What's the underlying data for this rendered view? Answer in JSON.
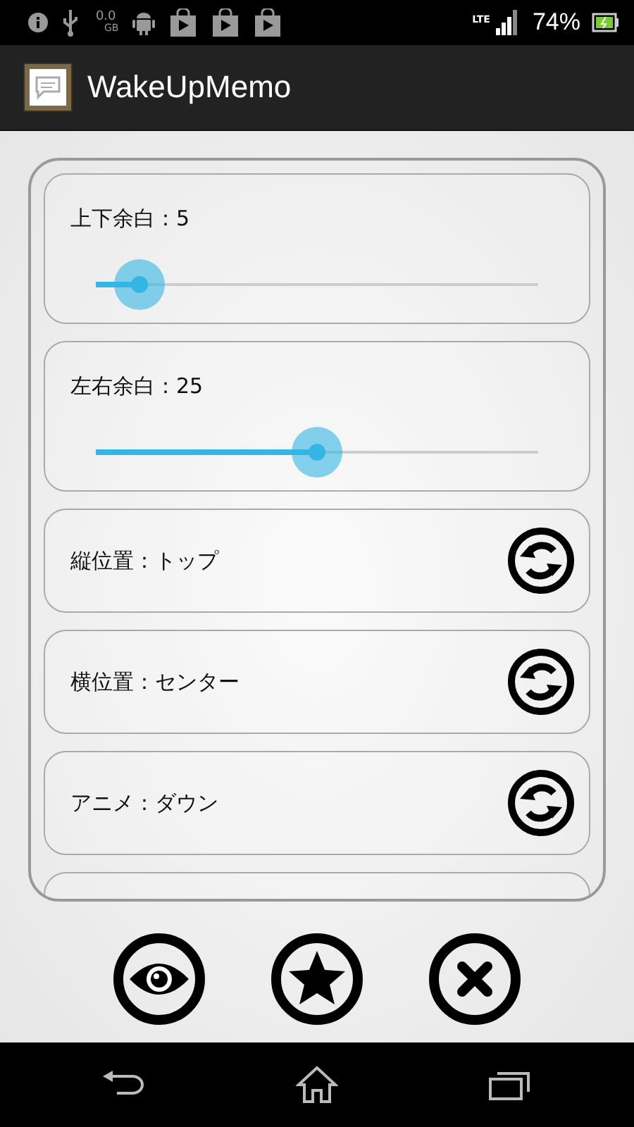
{
  "status_bar": {
    "data_usage": "0.0",
    "data_unit": "GB",
    "network": "LTE",
    "battery": "74%",
    "notifications": [
      {
        "kind": "info"
      },
      {
        "kind": "usb"
      },
      {
        "kind": "data"
      },
      {
        "kind": "android"
      },
      {
        "kind": "store"
      },
      {
        "kind": "store"
      },
      {
        "kind": "store"
      }
    ]
  },
  "app_bar": {
    "title": "WakeUpMemo"
  },
  "settings": [
    {
      "kind": "slider",
      "label": "上下余白：5",
      "level": 0.1
    },
    {
      "kind": "slider",
      "label": "左右余白：25",
      "level": 0.5
    },
    {
      "kind": "cycle",
      "label": "縦位置：トップ"
    },
    {
      "kind": "cycle",
      "label": "横位置：センター"
    },
    {
      "kind": "cycle",
      "label": "アニメ：ダウン"
    }
  ],
  "actions": [
    {
      "kind": "preview"
    },
    {
      "kind": "favorite"
    },
    {
      "kind": "close"
    }
  ]
}
